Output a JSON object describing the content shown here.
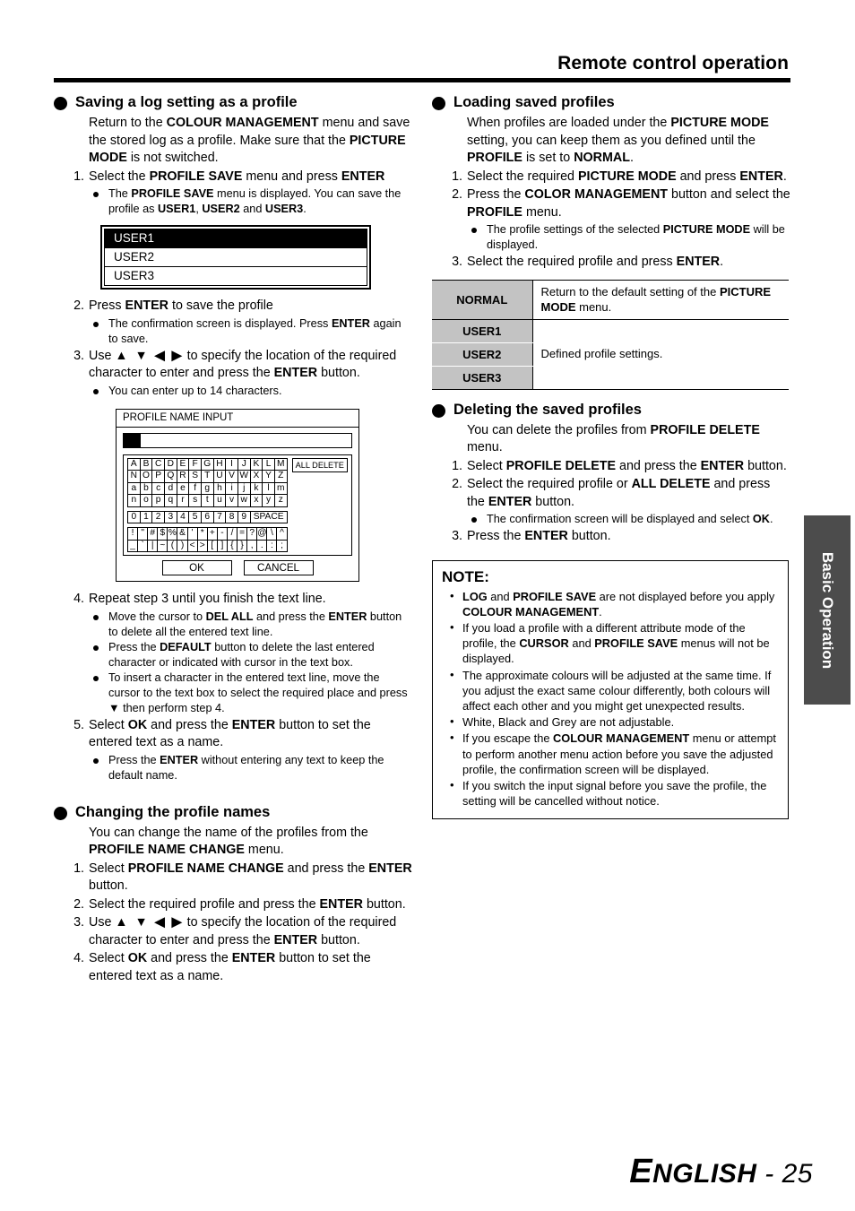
{
  "header": {
    "title": "Remote control operation"
  },
  "sidetab": {
    "label": "Basic Operation"
  },
  "footer": {
    "cap": "E",
    "rest": "NGLISH",
    "dash": " - ",
    "page": "25"
  },
  "left": {
    "s1": {
      "title": "Saving a log setting as a profile",
      "intro_1": "Return to the ",
      "intro_b1": "COLOUR MANAGEMENT",
      "intro_2": " menu and save the stored log as a profile. Make sure that the ",
      "intro_b2": "PICTURE MODE",
      "intro_3": " is not switched.",
      "step1_num": "1.",
      "step1_a": "Select the ",
      "step1_b": "PROFILE SAVE",
      "step1_c": " menu and press ",
      "step1_d": "ENTER",
      "step1_sub_a": "The ",
      "step1_sub_b": "PROFILE SAVE",
      "step1_sub_c": " menu is displayed. You can save the profile as ",
      "step1_sub_d": "USER1",
      "step1_sub_e": ", ",
      "step1_sub_f": "USER2",
      "step1_sub_g": " and ",
      "step1_sub_h": "USER3",
      "step1_sub_i": ".",
      "userlist": [
        "USER1",
        "USER2",
        "USER3"
      ],
      "userlist_selected": 0,
      "step2_num": "2.",
      "step2_a": "Press ",
      "step2_b": "ENTER",
      "step2_c": " to save the profile",
      "step2_sub_a": "The confirmation screen is displayed. Press ",
      "step2_sub_b": "ENTER",
      "step2_sub_c": " again to save.",
      "step3_num": "3.",
      "step3_a": "Use ",
      "step3_arrows": "▲ ▼ ◀ ▶",
      "step3_b": " to specify the location of the required character to enter and press the ",
      "step3_c": "ENTER",
      "step3_d": " button.",
      "step3_sub": "You can enter up to 14 characters.",
      "step4_num": "4.",
      "step4_a": "Repeat step 3 until you finish the text line.",
      "step4_sub1_a": "Move the cursor to ",
      "step4_sub1_b": "DEL ALL",
      "step4_sub1_c": " and press the ",
      "step4_sub1_d": "ENTER",
      "step4_sub1_e": " button to delete all the entered text line.",
      "step4_sub2_a": "Press the ",
      "step4_sub2_b": "DEFAULT",
      "step4_sub2_c": " button to delete the last entered character or indicated with cursor in the text box.",
      "step4_sub3_a": "To insert a character in the entered text line, move the cursor to the text box to select the required place and press ",
      "step4_sub3_arrow": "▼",
      "step4_sub3_b": " then perform step 4.",
      "step5_num": "5.",
      "step5_a": "Select ",
      "step5_b": "OK",
      "step5_c": " and press the ",
      "step5_d": "ENTER",
      "step5_e": " button to set the entered text as a name.",
      "step5_sub_a": "Press the ",
      "step5_sub_b": "ENTER",
      "step5_sub_c": " without entering any text to keep the default name."
    },
    "keyboard": {
      "title": "PROFILE NAME INPUT",
      "input_value": "",
      "all_delete": "ALL DELETE",
      "rows_alpha": [
        [
          "A",
          "B",
          "C",
          "D",
          "E",
          "F",
          "G",
          "H",
          "I",
          "J",
          "K",
          "L",
          "M"
        ],
        [
          "N",
          "O",
          "P",
          "Q",
          "R",
          "S",
          "T",
          "U",
          "V",
          "W",
          "X",
          "Y",
          "Z"
        ],
        [
          "a",
          "b",
          "c",
          "d",
          "e",
          "f",
          "g",
          "h",
          "i",
          "j",
          "k",
          "l",
          "m"
        ],
        [
          "n",
          "o",
          "p",
          "q",
          "r",
          "s",
          "t",
          "u",
          "v",
          "w",
          "x",
          "y",
          "z"
        ]
      ],
      "row_digits": [
        "0",
        "1",
        "2",
        "3",
        "4",
        "5",
        "6",
        "7",
        "8",
        "9"
      ],
      "space_label": "SPACE",
      "rows_symbols": [
        [
          "!",
          "\"",
          "#",
          "$",
          "%",
          "&",
          "'",
          "*",
          "+",
          "-",
          "/",
          "=",
          "?",
          "@",
          "\\",
          "^"
        ],
        [
          "_",
          "`",
          "|",
          "~",
          "(",
          ")",
          "<",
          ">",
          "[",
          "]",
          "{",
          "}",
          ",",
          ".",
          ":",
          ";"
        ]
      ],
      "ok": "OK",
      "cancel": "CANCEL"
    },
    "s2": {
      "title": "Changing the profile names",
      "intro_a": "You can change the name of the profiles from the ",
      "intro_b": "PROFILE NAME CHANGE",
      "intro_c": " menu.",
      "step1_num": "1.",
      "step1_a": "Select ",
      "step1_b": "PROFILE NAME CHANGE",
      "step1_c": " and press the ",
      "step1_d": "ENTER",
      "step1_e": " button.",
      "step2_num": "2.",
      "step2_a": "Select the required profile and press the ",
      "step2_b": "ENTER",
      "step2_c": " button.",
      "step3_num": "3.",
      "step3_a": "Use ",
      "step3_arrows": "▲ ▼ ◀ ▶",
      "step3_b": " to specify the location of the required character to enter and press the ",
      "step3_c": "ENTER",
      "step3_d": " button.",
      "step4_num": "4.",
      "step4_a": "Select ",
      "step4_b": "OK",
      "step4_c": " and press the ",
      "step4_d": "ENTER",
      "step4_e": " button to set the entered text as a name."
    }
  },
  "right": {
    "s1": {
      "title": "Loading saved profiles",
      "intro_a": "When profiles are loaded under the ",
      "intro_b": "PICTURE MODE",
      "intro_c": " setting, you can keep them as you defined until the ",
      "intro_d": "PROFILE",
      "intro_e": " is set to ",
      "intro_f": "NORMAL",
      "intro_g": ".",
      "step1_num": "1.",
      "step1_a": "Select the required ",
      "step1_b": "PICTURE MODE",
      "step1_c": " and press ",
      "step1_d": "ENTER",
      "step1_e": ".",
      "step2_num": "2.",
      "step2_a": "Press the ",
      "step2_b": "COLOR MANAGEMENT",
      "step2_c": " button and select the ",
      "step2_d": "PROFILE",
      "step2_e": " menu.",
      "step2_sub_a": "The profile settings of the selected ",
      "step2_sub_b": "PICTURE MODE",
      "step2_sub_c": " will be displayed.",
      "step3_num": "3.",
      "step3_a": "Select the required profile and press ",
      "step3_b": "ENTER",
      "step3_c": "."
    },
    "profile_table": {
      "rows": [
        {
          "key": "NORMAL",
          "value_a": "Return to the default setting of the ",
          "value_b": "PICTURE MODE",
          "value_c": " menu."
        },
        {
          "key": "USER1",
          "value_a": "",
          "value_b": "",
          "value_c": ""
        },
        {
          "key": "USER2",
          "value_a": "Defined profile settings.",
          "value_b": "",
          "value_c": ""
        },
        {
          "key": "USER3",
          "value_a": "",
          "value_b": "",
          "value_c": ""
        }
      ]
    },
    "s2": {
      "title": "Deleting the saved profiles",
      "intro_a": "You can delete the profiles from ",
      "intro_b": "PROFILE DELETE",
      "intro_c": " menu.",
      "step1_num": "1.",
      "step1_a": "Select ",
      "step1_b": "PROFILE DELETE",
      "step1_c": " and press the ",
      "step1_d": "ENTER",
      "step1_e": " button.",
      "step2_num": "2.",
      "step2_a": "Select the required profile or ",
      "step2_b": "ALL DELETE",
      "step2_c": " and press the ",
      "step2_d": "ENTER",
      "step2_e": " button.",
      "step2_sub_a": "The confirmation screen will be displayed and select ",
      "step2_sub_b": "OK",
      "step2_sub_c": ".",
      "step3_num": "3.",
      "step3_a": "Press the ",
      "step3_b": "ENTER",
      "step3_c": " button."
    },
    "note": {
      "title": "NOTE:",
      "items": [
        {
          "a": "",
          "b": "LOG",
          "c": " and ",
          "d": "PROFILE SAVE",
          "e": " are not displayed before you apply ",
          "f": "COLOUR MANAGEMENT",
          "g": "."
        },
        {
          "a": "If you load a profile with a different attribute mode of the profile, the ",
          "b": "CURSOR",
          "c": " and ",
          "d": "PROFILE SAVE",
          "e": " menus will not be displayed.",
          "f": "",
          "g": ""
        },
        {
          "a": "The approximate colours will be adjusted at the same time. If you adjust the exact same colour differently, both colours will affect each other and you might get unexpected results.",
          "b": "",
          "c": "",
          "d": "",
          "e": "",
          "f": "",
          "g": ""
        },
        {
          "a": "White, Black and Grey are not adjustable.",
          "b": "",
          "c": "",
          "d": "",
          "e": "",
          "f": "",
          "g": ""
        },
        {
          "a": "If you escape the ",
          "b": "COLOUR MANAGEMENT",
          "c": " menu or attempt to perform another menu action before you save the adjusted profile, the confirmation screen will be displayed.",
          "d": "",
          "e": "",
          "f": "",
          "g": ""
        },
        {
          "a": "If you switch the input signal before you save the profile, the setting will be cancelled without notice.",
          "b": "",
          "c": "",
          "d": "",
          "e": "",
          "f": "",
          "g": ""
        }
      ]
    }
  }
}
